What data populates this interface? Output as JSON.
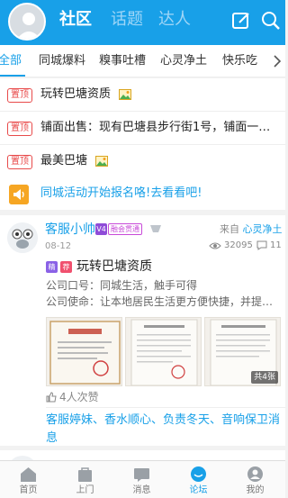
{
  "header": {
    "tabs": [
      {
        "label": "社区",
        "active": true
      },
      {
        "label": "话题",
        "active": false
      },
      {
        "label": "达人",
        "active": false
      }
    ],
    "icons": [
      "edit-icon",
      "search-icon"
    ],
    "brand_color": "#18a0e8"
  },
  "categories": [
    {
      "label": "全部",
      "active": true
    },
    {
      "label": "同城爆料",
      "active": false
    },
    {
      "label": "糗事吐槽",
      "active": false
    },
    {
      "label": "心灵净土",
      "active": false
    },
    {
      "label": "快乐吃",
      "active": false
    }
  ],
  "pinned": [
    {
      "badge": "置顶",
      "title": "玩转巴塘资质",
      "has_image": true
    },
    {
      "badge": "置顶",
      "title": "铺面出售：现有巴塘县步行街1号，铺面一…",
      "has_image": false
    },
    {
      "badge": "置顶",
      "title": "最美巴塘",
      "has_image": true
    }
  ],
  "announcement": {
    "text": "同城活动开始报名咯!去看看吧!",
    "icon": "speaker-icon"
  },
  "post": {
    "author": "客服小帅",
    "v_badge": "V4",
    "level_badge": "融会贯通",
    "from_label": "来自",
    "from_source": "心灵净土",
    "date": "08-12",
    "views": "32095",
    "comments": "11",
    "tag_jing": "精",
    "tag_jian": "荐",
    "title": "玩转巴塘资质",
    "line1": "公司口号：同城生活，触手可得",
    "line2": "公司使命：让本地居民生活更方便快捷，并提供全…",
    "image_count": "共4张",
    "likes": "4人次赞",
    "reply_tags": "客服婷妹、香水顺心、负责冬天、音响保卫消息"
  },
  "bottom_nav": [
    {
      "label": "首页",
      "icon": "home-icon",
      "active": false
    },
    {
      "label": "上门",
      "icon": "bag-icon",
      "active": false
    },
    {
      "label": "消息",
      "icon": "message-icon",
      "active": false
    },
    {
      "label": "论坛",
      "icon": "forum-icon",
      "active": true
    },
    {
      "label": "我的",
      "icon": "profile-icon",
      "active": false
    }
  ]
}
